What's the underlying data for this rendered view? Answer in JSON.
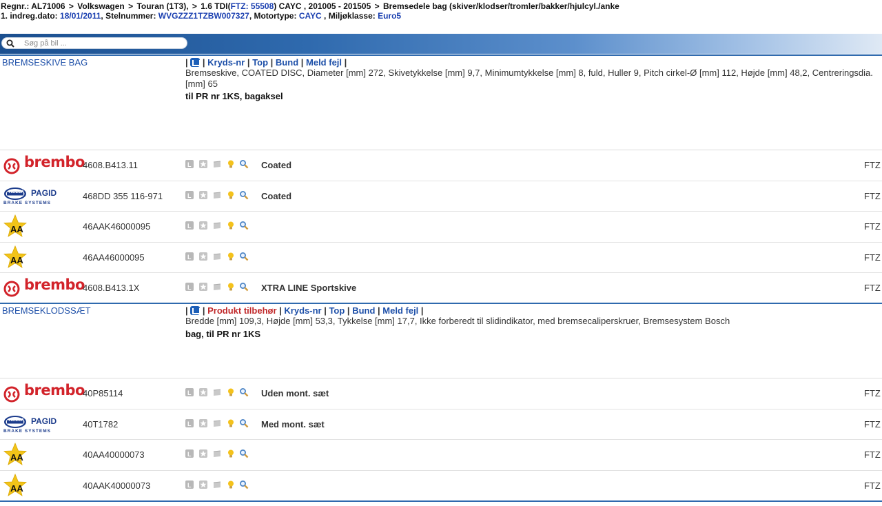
{
  "header": {
    "line1": [
      {
        "t": "Regnr.: AL71006",
        "c": ""
      },
      {
        "t": " > ",
        "c": "sep"
      },
      {
        "t": " Volkswagen",
        "c": ""
      },
      {
        "t": " > ",
        "c": "sep"
      },
      {
        "t": "Touran (1T3),",
        "c": ""
      },
      {
        "t": " > ",
        "c": "sep"
      },
      {
        "t": "1.6 TDI(",
        "c": ""
      },
      {
        "t": "FTZ: 55508",
        "c": "lnk"
      },
      {
        "t": ") CAYC , 201005  - 201505",
        "c": ""
      },
      {
        "t": " > ",
        "c": "sep"
      },
      {
        "t": "Bremsedele bag (skiver/klodser/tromler/bakker/hjulcyl./anke",
        "c": ""
      }
    ],
    "line2": [
      {
        "t": "1. indreg.dato: ",
        "c": ""
      },
      {
        "t": "18/01/2011",
        "c": "lnk"
      },
      {
        "t": ",  Stelnummer: ",
        "c": ""
      },
      {
        "t": "WVGZZZ1TZBW007327",
        "c": "lnk"
      },
      {
        "t": ",  Motortype: ",
        "c": ""
      },
      {
        "t": "CAYC",
        "c": "lnk"
      },
      {
        "t": " , Miljøklasse: ",
        "c": ""
      },
      {
        "t": "Euro5",
        "c": "lnk"
      }
    ]
  },
  "search": {
    "placeholder": "Søg på bil ...",
    "value": ""
  },
  "icon_names": [
    "info-l-icon",
    "star-icon",
    "box-icon",
    "bulb-icon",
    "search-icon"
  ],
  "sections": [
    {
      "title": "BREMSESKIVE BAG",
      "links": [
        "Kryds-nr",
        "Top",
        "Bund",
        "Meld fejl"
      ],
      "product_link": "",
      "description": "Bremseskive, COATED DISC, Diameter [mm] 272, Skivetykkelse [mm] 9,7, Minimumtykkelse [mm] 8, fuld, Huller 9, Pitch cirkel-Ø [mm] 112, Højde [mm] 48,2, Centreringsdia. [mm] 65",
      "note": "til PR nr 1KS, bagaksel",
      "rows": [
        {
          "brand": "brembo",
          "part": "4608.B413.11",
          "note": "Coated",
          "ftz": "FTZ"
        },
        {
          "brand": "hella",
          "part": "468DD 355 116-971",
          "note": "Coated",
          "ftz": "FTZ"
        },
        {
          "brand": "aa",
          "part": "46AAK46000095",
          "note": "",
          "ftz": "FTZ"
        },
        {
          "brand": "aa",
          "part": "46AA46000095",
          "note": "",
          "ftz": "FTZ"
        },
        {
          "brand": "brembo",
          "part": "4608.B413.1X",
          "note": "XTRA LINE Sportskive",
          "ftz": "FTZ"
        }
      ]
    },
    {
      "title": "BREMSEKLODSSÆT",
      "links": [
        "Kryds-nr",
        "Top",
        "Bund",
        "Meld fejl"
      ],
      "product_link": "Produkt tilbehør",
      "description": "Bredde [mm] 109,3, Højde [mm] 53,3, Tykkelse [mm] 17,7, Ikke forberedt til slidindikator, med bremsecaliperskruer, Bremsesystem Bosch",
      "note": "bag, til PR nr 1KS",
      "rows": [
        {
          "brand": "brembo",
          "part": "40P85114",
          "note": "Uden mont. sæt",
          "ftz": "FTZ"
        },
        {
          "brand": "hella",
          "part": "40T1782",
          "note": "Med mont. sæt",
          "ftz": "FTZ"
        },
        {
          "brand": "aa",
          "part": "40AA40000073",
          "note": "",
          "ftz": "FTZ"
        },
        {
          "brand": "aa",
          "part": "40AAK40000073",
          "note": "",
          "ftz": "FTZ"
        }
      ]
    }
  ],
  "brands": {
    "brembo": "brembo",
    "hella_main": "PAGID",
    "hella_badge": "HELLA",
    "hella_sub": "BRAKE SYSTEMS",
    "aa": "AA"
  },
  "colors": {
    "link": "#1d4fa8",
    "brembo_red": "#d2232a",
    "accent_blue": "#2f6aae",
    "red_link": "#c0282a"
  }
}
